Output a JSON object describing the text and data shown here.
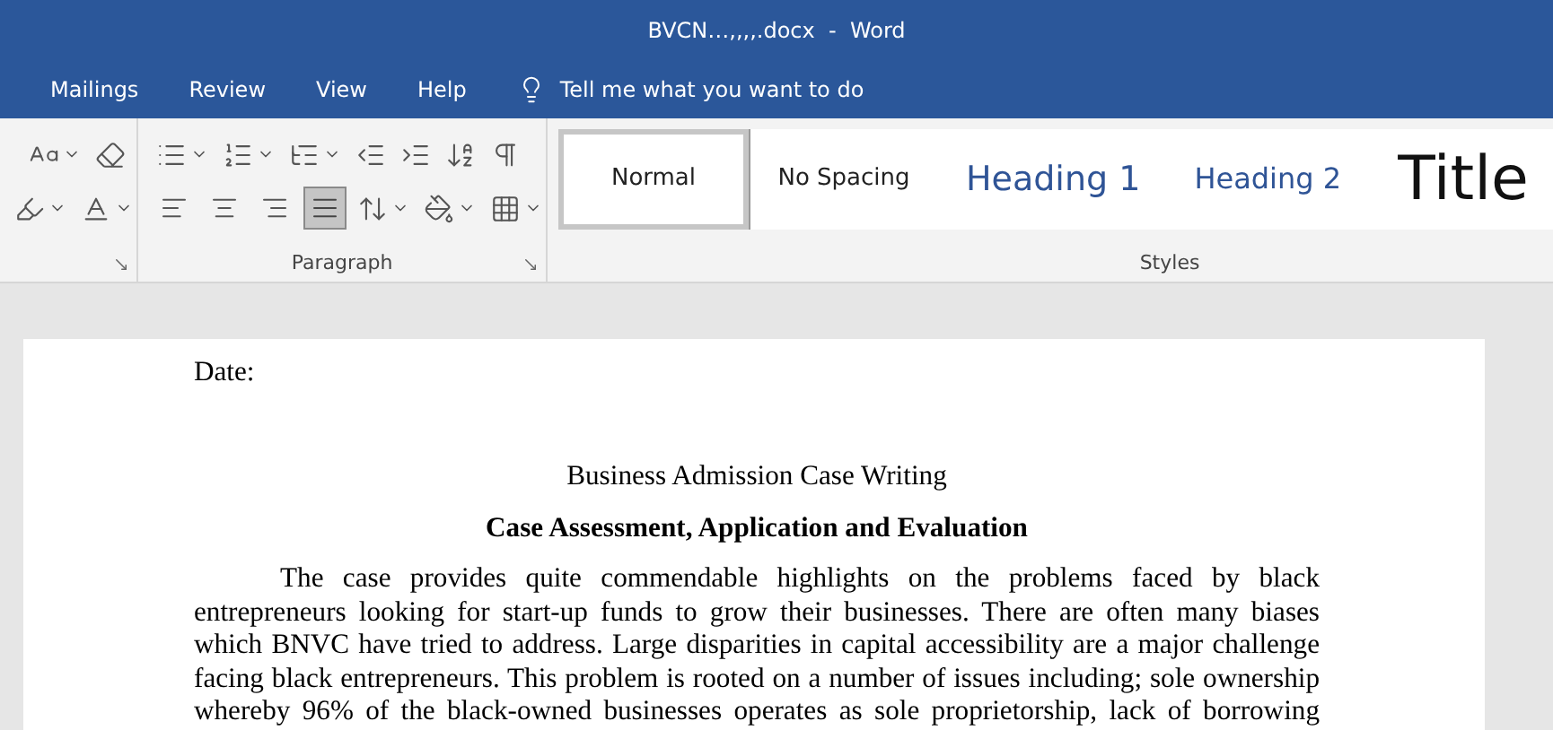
{
  "window": {
    "title": "BVCN…,,,,.docx  -  Word"
  },
  "tabs": [
    {
      "label": "Mailings"
    },
    {
      "label": "Review"
    },
    {
      "label": "View"
    },
    {
      "label": "Help"
    }
  ],
  "tell_me": {
    "placeholder": "Tell me what you want to do"
  },
  "ribbon": {
    "paragraph_group": {
      "label": "Paragraph",
      "alignment": [
        {
          "kind": "left",
          "selected": false
        },
        {
          "kind": "center",
          "selected": false
        },
        {
          "kind": "right",
          "selected": false
        },
        {
          "kind": "justify",
          "selected": true
        }
      ]
    },
    "styles_group": {
      "label": "Styles",
      "styles": [
        {
          "label": "Normal",
          "kind": "normal",
          "selected": true
        },
        {
          "label": "No Spacing",
          "kind": "normal",
          "selected": false
        },
        {
          "label": "Heading 1",
          "kind": "heading1",
          "selected": false
        },
        {
          "label": "Heading 2",
          "kind": "heading2",
          "selected": false
        },
        {
          "label": "Title",
          "kind": "title",
          "selected": false
        }
      ]
    }
  },
  "document": {
    "date_label": "Date:",
    "title": "Business Admission Case Writing",
    "heading": "Case Assessment, Application and Evaluation",
    "paragraph": "The case provides quite commendable highlights on the problems faced by black entrepreneurs looking for start-up funds to grow their businesses. There are often many biases which BNVC have tried to address. Large disparities in capital accessibility are a major challenge facing black entrepreneurs. This problem is rooted on a number of issues including; sole ownership whereby 96% of the black-owned businesses operates as sole proprietorship, lack of borrowing"
  }
}
